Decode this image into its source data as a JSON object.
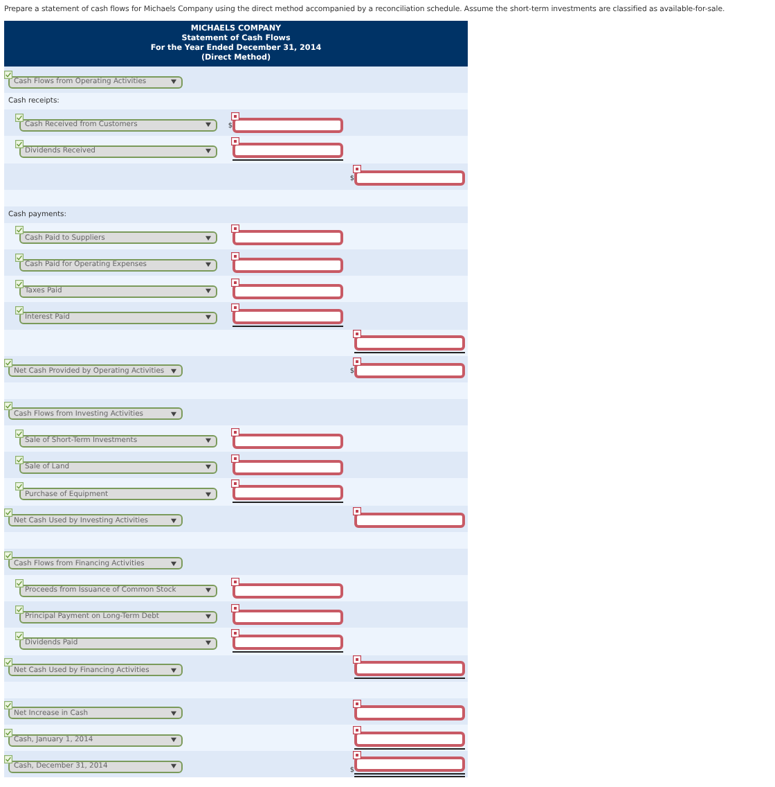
{
  "instructions": "Prepare a statement of cash flows for Michaels Company using the direct method accompanied by a reconciliation schedule. Assume the short-term investments are classified as available-for-sale.",
  "header": [
    "MICHAELS COMPANY",
    "Statement of Cash Flows",
    "For the Year Ended December 31, 2014",
    "(Direct Method)"
  ],
  "rows": [
    {
      "kind": "section",
      "value": "Cash Flows from Operating Activities"
    },
    {
      "kind": "label",
      "text": "Cash receipts:"
    },
    {
      "kind": "item",
      "value": "Cash Received from Customers",
      "prefix": "$",
      "underlined": false
    },
    {
      "kind": "item",
      "value": "Dividends Received",
      "underlined": true
    },
    {
      "kind": "subtotal",
      "prefix": "$",
      "underlined": false
    },
    {
      "kind": "blank"
    },
    {
      "kind": "label",
      "text": "Cash payments:"
    },
    {
      "kind": "item",
      "value": "Cash Paid to Suppliers",
      "underlined": false
    },
    {
      "kind": "item",
      "value": "Cash Paid for Operating Expenses",
      "underlined": false
    },
    {
      "kind": "item",
      "value": "Taxes Paid",
      "underlined": false
    },
    {
      "kind": "item",
      "value": "Interest Paid",
      "underlined": true
    },
    {
      "kind": "subtotal",
      "underlined": true
    },
    {
      "kind": "total",
      "value": "Net Cash Provided by Operating Activities",
      "prefix": "$",
      "underlined": false
    },
    {
      "kind": "blank"
    },
    {
      "kind": "section",
      "value": "Cash Flows from Investing Activities"
    },
    {
      "kind": "item",
      "value": "Sale of Short-Term Investments",
      "underlined": false
    },
    {
      "kind": "item",
      "value": "Sale of Land",
      "underlined": false
    },
    {
      "kind": "item",
      "value": "Purchase of Equipment",
      "underlined": true
    },
    {
      "kind": "total",
      "value": "Net Cash Used by Investing Activities",
      "underlined": false
    },
    {
      "kind": "blank"
    },
    {
      "kind": "section",
      "value": "Cash Flows from Financing Activities"
    },
    {
      "kind": "item",
      "value": "Proceeds from Issuance of Common Stock",
      "underlined": false
    },
    {
      "kind": "item",
      "value": "Principal Payment on Long-Term Debt",
      "underlined": false
    },
    {
      "kind": "item",
      "value": "Dividends Paid",
      "underlined": true
    },
    {
      "kind": "total",
      "value": "Net Cash Used by Financing Activities",
      "underlined": true
    },
    {
      "kind": "blank"
    },
    {
      "kind": "total",
      "value": "Net Increase in Cash",
      "underlined": false
    },
    {
      "kind": "total",
      "value": "Cash, January 1, 2014",
      "underlined": true
    },
    {
      "kind": "total",
      "value": "Cash, December 31, 2014",
      "prefix": "$",
      "underlined": true,
      "double_underlined": true
    }
  ]
}
